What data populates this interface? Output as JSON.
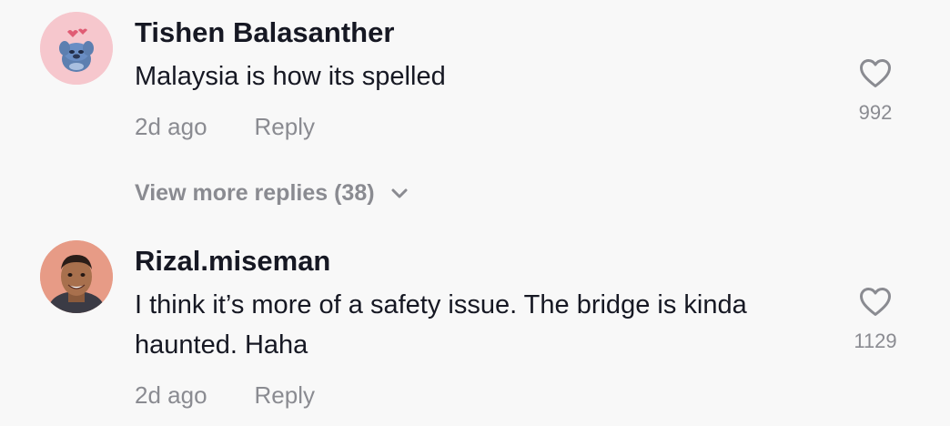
{
  "comments": [
    {
      "username": "Tishen Balasanther",
      "text": "Malaysia is how its spelled",
      "time": "2d ago",
      "reply_label": "Reply",
      "likes": "992",
      "avatar_icon": "stitch-avatar-icon"
    },
    {
      "username": "Rizal.miseman",
      "text": "I think it’s more of a safety issue. The bridge is kinda haunted. Haha",
      "time": "2d ago",
      "reply_label": "Reply",
      "likes": "1129",
      "avatar_icon": "person-avatar-icon"
    }
  ],
  "view_more": {
    "label": "View more replies (38)",
    "icon": "chevron-down-icon"
  },
  "colors": {
    "background": "#f8f8f8",
    "primary_text": "#161823",
    "secondary_text": "#8a8b91"
  }
}
